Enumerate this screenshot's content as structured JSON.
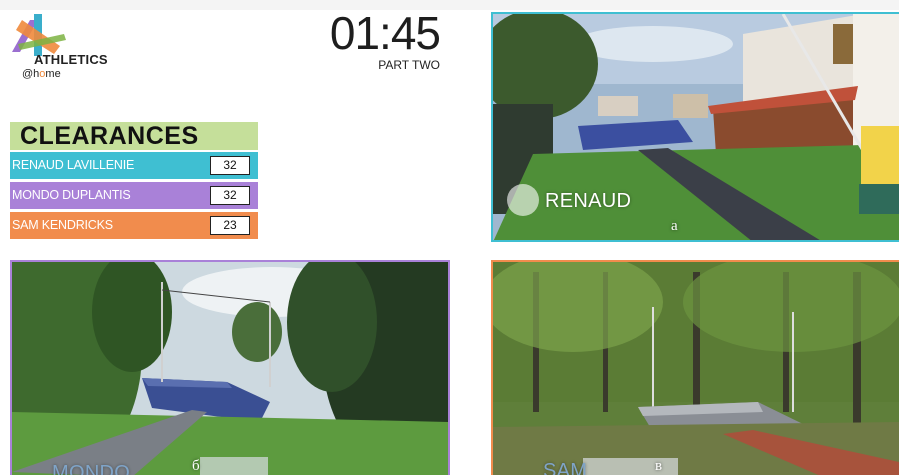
{
  "logo": {
    "line1": "ATHLETICS",
    "line2_a": "@h",
    "line2_b": "o",
    "line2_c": "me",
    "colors": {
      "green": "#7cb342",
      "orange": "#f08a3c",
      "teal": "#3aaecb",
      "purple": "#9b6fd0"
    }
  },
  "timer": {
    "value": "01:45",
    "label": "PART TWO"
  },
  "scoreboard": {
    "title": "CLEARANCES",
    "rows": [
      {
        "name": "RENAUD LAVILLENIE",
        "value": "32",
        "color": "#3fbfd2"
      },
      {
        "name": "MONDO DUPLANTIS",
        "value": "32",
        "color": "#a981d8"
      },
      {
        "name": "SAM KENDRICKS",
        "value": "23",
        "color": "#f18c4d"
      }
    ]
  },
  "panels": [
    {
      "caption": "RENAUD",
      "letter": "a",
      "border": "#3fbfd2"
    },
    {
      "caption": "MONDO",
      "letter": "б",
      "border": "#a981d8"
    },
    {
      "caption": "SAM",
      "letter": "в",
      "border": "#f18c4d"
    }
  ]
}
